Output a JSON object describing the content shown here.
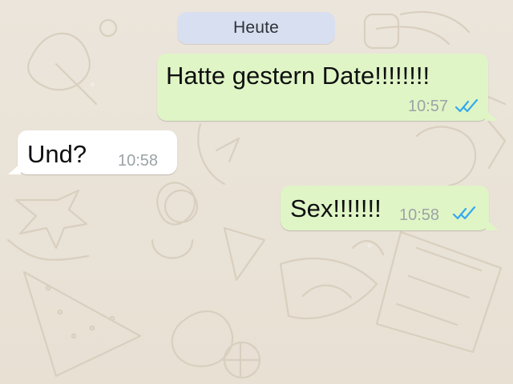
{
  "conversation": {
    "date_label": "Heute",
    "messages": [
      {
        "direction": "out",
        "text": "Hatte gestern Date!!!!!!!!",
        "time": "10:57",
        "status_icon": "double-check-read"
      },
      {
        "direction": "in",
        "text": "Und?",
        "time": "10:58"
      },
      {
        "direction": "out",
        "text": "Sex!!!!!!!",
        "time": "10:58",
        "status_icon": "double-check-read"
      }
    ]
  },
  "colors": {
    "background": "#e9e2d6",
    "outgoing_bubble": "#dff5c6",
    "incoming_bubble": "#ffffff",
    "date_pill": "#d8dff0",
    "read_checks": "#35a9ee",
    "timestamp": "#9ca3a6"
  }
}
